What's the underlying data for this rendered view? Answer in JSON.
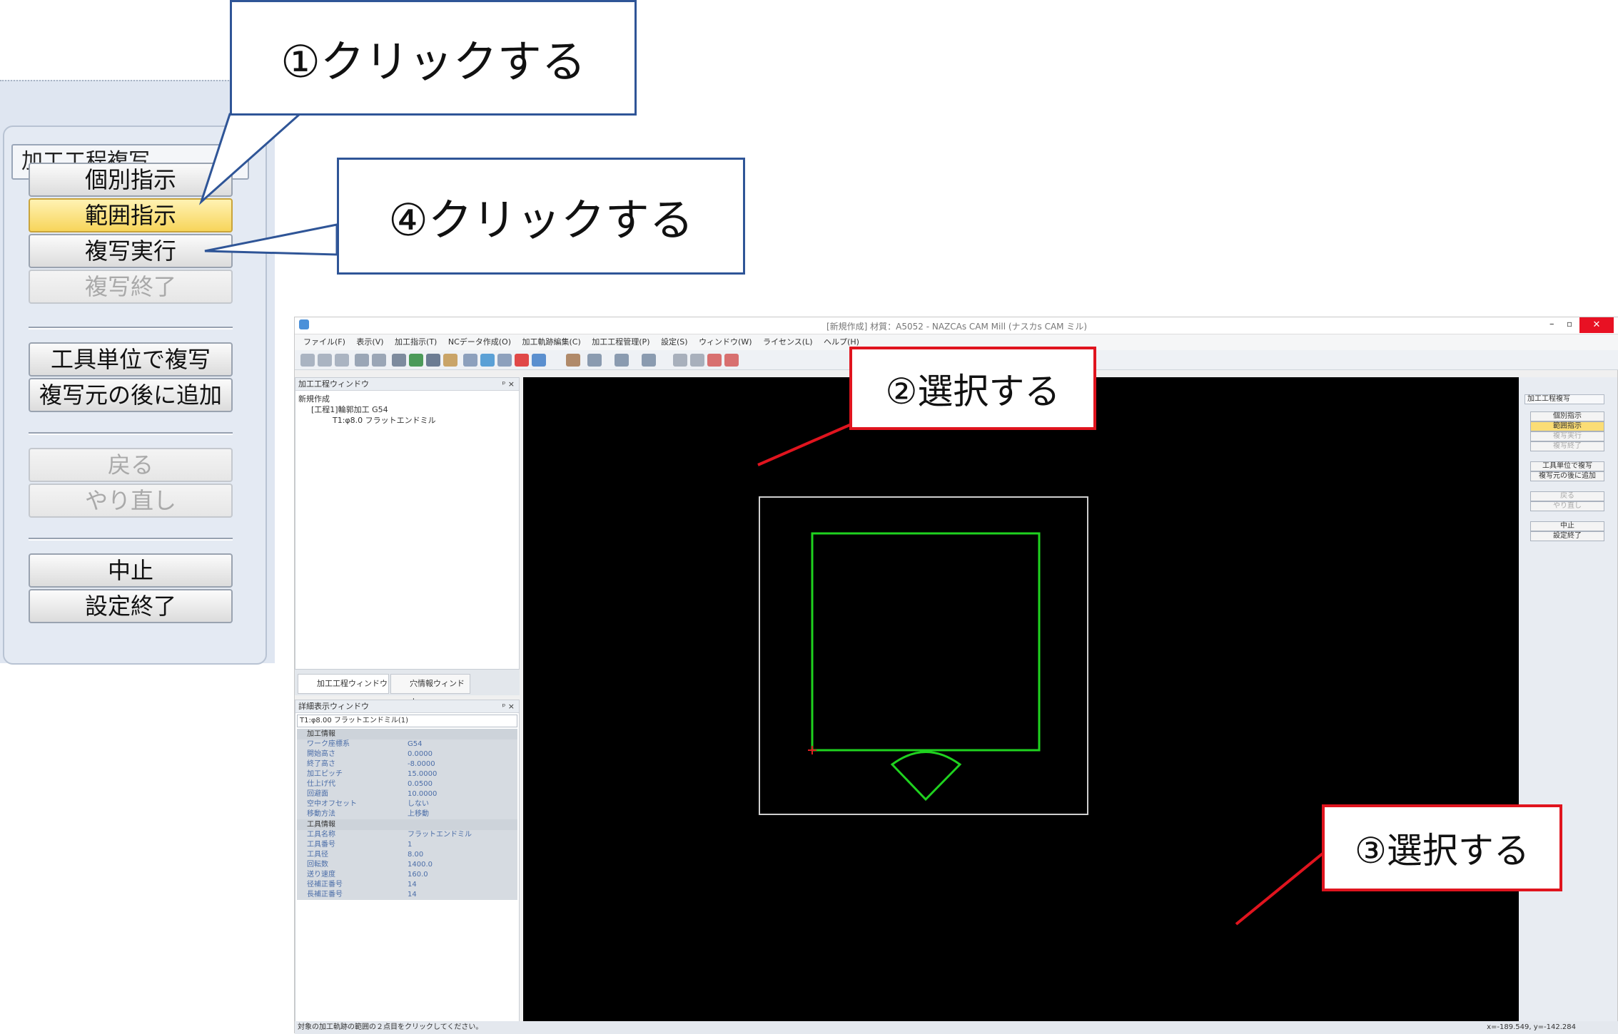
{
  "zoom_panel": {
    "title": "加工工程複写",
    "buttons": [
      {
        "label": "個別指示",
        "state": "normal"
      },
      {
        "label": "範囲指示",
        "state": "highlighted"
      },
      {
        "label": "複写実行",
        "state": "normal"
      },
      {
        "label": "複写終了",
        "state": "disabled"
      },
      {
        "label": "工具単位で複写",
        "state": "normal"
      },
      {
        "label": "複写元の後に追加",
        "state": "normal"
      },
      {
        "label": "戻る",
        "state": "disabled"
      },
      {
        "label": "やり直し",
        "state": "disabled"
      },
      {
        "label": "中止",
        "state": "normal"
      },
      {
        "label": "設定終了",
        "state": "normal"
      }
    ]
  },
  "callouts": {
    "c1": "①クリックする",
    "c4": "④クリックする",
    "c2": "②選択する",
    "c3": "③選択する"
  },
  "app": {
    "title": "[新規作成] 材質：A5052 - NAZCAs CAM Mill (ナスカs CAM ミル)",
    "menu": [
      "ファイル(F)",
      "表示(V)",
      "加工指示(T)",
      "NCデータ作成(O)",
      "加工軌跡編集(C)",
      "加工工程管理(P)",
      "設定(S)",
      "ウィンドウ(W)",
      "ライセンス(L)",
      "ヘルプ(H)"
    ],
    "tree_panel": {
      "title": "加工工程ウィンドウ",
      "items": [
        "新規作成",
        "[工程1]輪郭加工 G54",
        "T1:φ8.0 フラットエンドミル"
      ]
    },
    "tabs": [
      "加工工程ウィンドウ",
      "穴情報ウィンドウ"
    ],
    "detail_panel": {
      "title": "詳細表示ウィンドウ",
      "select": "T1:φ8.00 フラットエンドミル(1)",
      "group1": "加工情報",
      "rows1": [
        {
          "k": "ワーク座標系",
          "v": "G54"
        },
        {
          "k": "開始高さ",
          "v": "0.0000"
        },
        {
          "k": "終了高さ",
          "v": "-8.0000"
        },
        {
          "k": "加工ピッチ",
          "v": "15.0000"
        },
        {
          "k": "仕上げ代",
          "v": "0.0500"
        },
        {
          "k": "回避面",
          "v": "10.0000"
        },
        {
          "k": "空中オフセット",
          "v": "しない"
        },
        {
          "k": "移動方法",
          "v": "上移動"
        }
      ],
      "group2": "工具情報",
      "rows2": [
        {
          "k": "工具名称",
          "v": "フラットエンドミル"
        },
        {
          "k": "工具番号",
          "v": "1"
        },
        {
          "k": "工具径",
          "v": "8.00"
        },
        {
          "k": "回転数",
          "v": "1400.0"
        },
        {
          "k": "送り速度",
          "v": "160.0"
        },
        {
          "k": "径補正番号",
          "v": "14"
        },
        {
          "k": "長補正番号",
          "v": "14"
        }
      ]
    },
    "mini_panel": {
      "title": "加工工程複写",
      "buttons": [
        "個別指示",
        "範囲指示",
        "複写実行",
        "複写終了",
        "工具単位で複写",
        "複写元の後に追加",
        "戻る",
        "やり直し",
        "中止",
        "設定終了"
      ]
    },
    "status_text": "対象の加工軌跡の範囲の２点目をクリックしてください。",
    "coords": "x=-189.549,  y=-142.284"
  }
}
